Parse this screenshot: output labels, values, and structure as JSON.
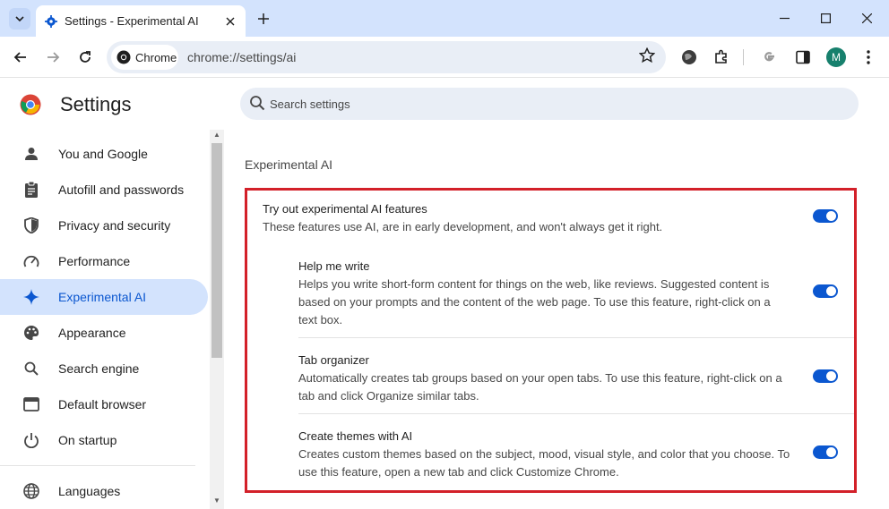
{
  "window": {
    "tab_title": "Settings - Experimental AI"
  },
  "toolbar": {
    "chip_label": "Chrome",
    "url": "chrome://settings/ai",
    "avatar_letter": "M"
  },
  "sidebar": {
    "title": "Settings",
    "items": [
      {
        "label": "You and Google",
        "icon": "person-icon"
      },
      {
        "label": "Autofill and passwords",
        "icon": "clipboard-icon"
      },
      {
        "label": "Privacy and security",
        "icon": "shield-icon"
      },
      {
        "label": "Performance",
        "icon": "speedometer-icon"
      },
      {
        "label": "Experimental AI",
        "icon": "sparkle-icon",
        "active": true
      },
      {
        "label": "Appearance",
        "icon": "palette-icon"
      },
      {
        "label": "Search engine",
        "icon": "search-icon"
      },
      {
        "label": "Default browser",
        "icon": "browser-window-icon"
      },
      {
        "label": "On startup",
        "icon": "power-icon"
      },
      {
        "label": "Languages",
        "icon": "globe-icon"
      }
    ]
  },
  "search": {
    "placeholder": "Search settings"
  },
  "main": {
    "section_title": "Experimental AI",
    "main_feature": {
      "title": "Try out experimental AI features",
      "desc": "These features use AI, are in early development, and won't always get it right.",
      "enabled": true
    },
    "features": [
      {
        "title": "Help me write",
        "desc_lines": [
          "Helps you write short-form content for things on the web, like reviews. Suggested content is",
          "based on your prompts and the content of the web page. To use this feature, right-click on a",
          "text box."
        ],
        "enabled": true
      },
      {
        "title": "Tab organizer",
        "desc_lines": [
          "Automatically creates tab groups based on your open tabs. To use this feature, right-click on a",
          "tab and click Organize similar tabs."
        ],
        "enabled": true
      },
      {
        "title": "Create themes with AI",
        "desc_lines": [
          "Creates custom themes based on the subject, mood, visual style, and color that you choose. To",
          "use this feature, open a new tab and click Customize Chrome."
        ],
        "enabled": true
      }
    ]
  },
  "colors": {
    "accent": "#0b57d0",
    "highlight_border": "#d32029",
    "active_bg": "#d3e3fd"
  }
}
